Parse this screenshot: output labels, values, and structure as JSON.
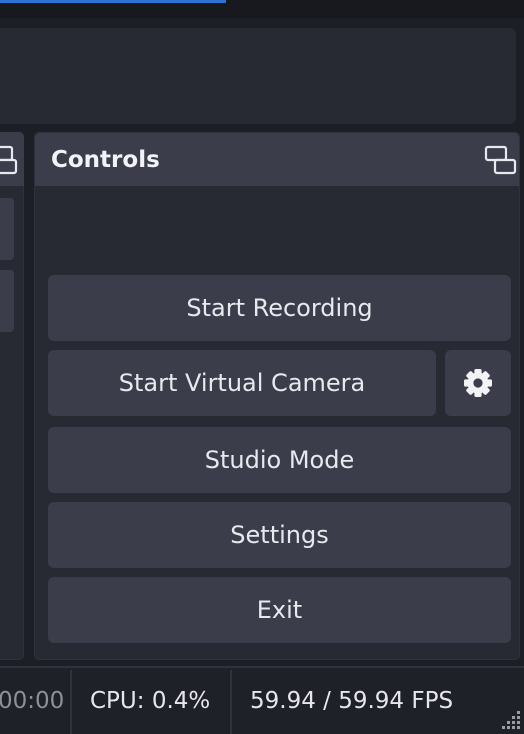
{
  "controls": {
    "title": "Controls",
    "buttons": {
      "start_recording": "Start Recording",
      "start_virtual_camera": "Start Virtual Camera",
      "studio_mode": "Studio Mode",
      "settings": "Settings",
      "exit": "Exit"
    }
  },
  "status_bar": {
    "time_partial": "00:00",
    "cpu": "CPU: 0.4%",
    "fps": "59.94 / 59.94 FPS"
  },
  "icons": {
    "undock": "undock-icon",
    "virtual_camera_settings": "gear-icon",
    "resize": "resize-grip-icon"
  },
  "colors": {
    "background": "#1d1f26",
    "panel": "#272a33",
    "button": "#3b3e4a",
    "accent": "#2c73d2",
    "text": "#e8e8ee"
  }
}
